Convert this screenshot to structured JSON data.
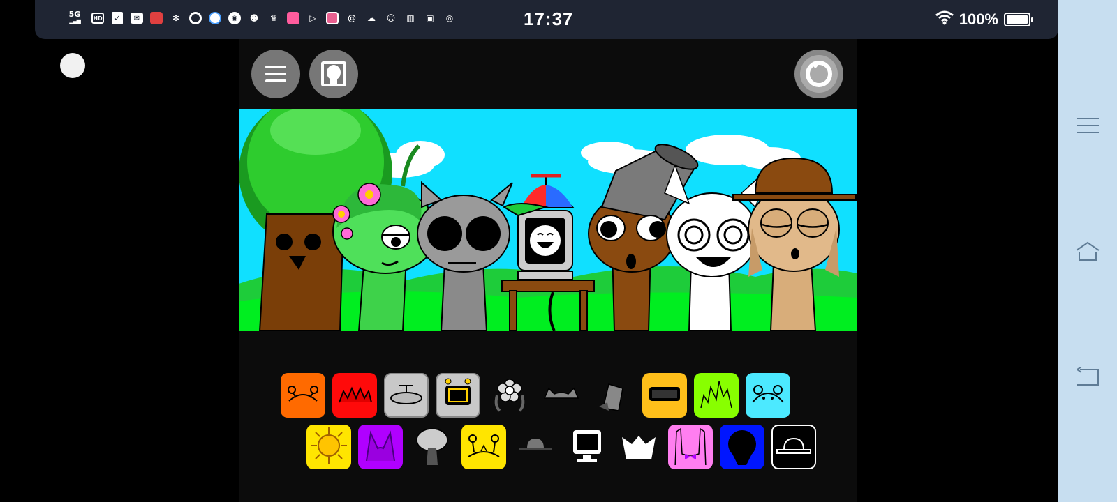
{
  "status_bar": {
    "network": "5G",
    "time": "17:37",
    "battery": "100%",
    "battery_level": 1.0,
    "notification_icons": [
      "hd-icon",
      "check-icon",
      "mail-icon",
      "app-red-icon",
      "pinwheel-icon",
      "q-icon",
      "browser-icon",
      "voice-icon",
      "robot-icon",
      "crown-icon",
      "app-pink-icon",
      "play-icon",
      "app-blue-icon",
      "at-icon",
      "cloud-icon",
      "game-icon",
      "book-icon",
      "photo-icon",
      "compass-icon"
    ]
  },
  "toolbar": {
    "menu_icon": "menu-icon",
    "character_icon": "character-icon",
    "reset_icon": "reset-icon"
  },
  "scene": {
    "characters": [
      "tree",
      "green-plant",
      "gray-cat",
      "computer",
      "brown-bucket",
      "white-cat",
      "tan-hat"
    ]
  },
  "palette": {
    "row1": [
      {
        "name": "orange-antenna",
        "color": "#ff6a00",
        "boxed": true
      },
      {
        "name": "red-spikes",
        "color": "#ff0a0a",
        "boxed": true
      },
      {
        "name": "gray-satellite",
        "color": "#c8c8c8",
        "boxed": true
      },
      {
        "name": "gray-computer",
        "color": "#c8c8c8",
        "boxed": true
      },
      {
        "name": "flower",
        "color": "",
        "boxed": false
      },
      {
        "name": "cat-ears",
        "color": "",
        "boxed": false
      },
      {
        "name": "bucket",
        "color": "",
        "boxed": false
      },
      {
        "name": "yellow-visor",
        "color": "#ffbf1a",
        "boxed": true
      },
      {
        "name": "lime-grass",
        "color": "#88ff00",
        "boxed": true
      },
      {
        "name": "cyan-bear",
        "color": "#4ce9ff",
        "boxed": true
      }
    ],
    "row2": [
      {
        "name": "yellow-sun",
        "color": "#ffe500",
        "boxed": true
      },
      {
        "name": "purple-horns",
        "color": "#b000ff",
        "boxed": true
      },
      {
        "name": "mushroom",
        "color": "",
        "boxed": false
      },
      {
        "name": "yellow-antenna",
        "color": "#ffe500",
        "boxed": true
      },
      {
        "name": "small-hat",
        "color": "",
        "boxed": false
      },
      {
        "name": "monitor",
        "color": "",
        "boxed": false
      },
      {
        "name": "white-crown",
        "color": "",
        "boxed": false
      },
      {
        "name": "pink-bow",
        "color": "#ff7ef0",
        "boxed": true
      },
      {
        "name": "blue-hood",
        "color": "#0016ff",
        "boxed": true
      },
      {
        "name": "black-hat",
        "color": "#000000",
        "boxed": true
      }
    ]
  }
}
